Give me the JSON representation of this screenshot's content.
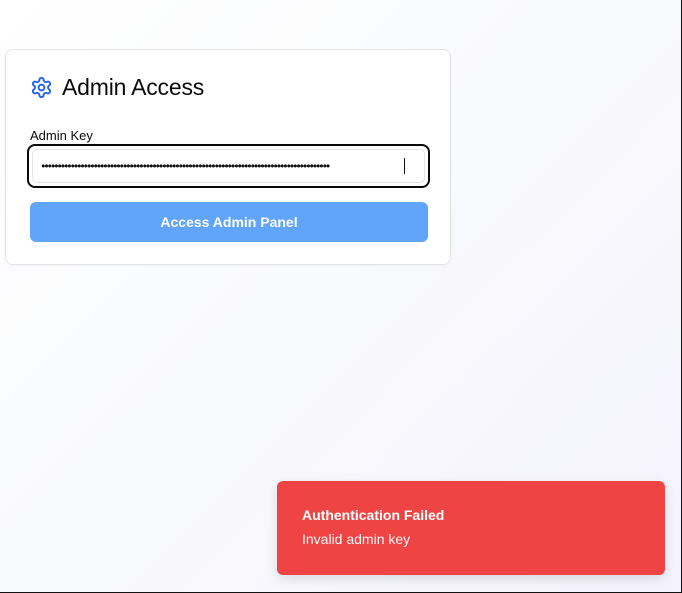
{
  "card": {
    "title": "Admin Access",
    "icon": "gear-icon",
    "key_label": "Admin Key",
    "key_value_masked": "••••••••••••••••••••••••••••••••••••••••••••••••••••••••••••••••••••••••••••••••••••••••",
    "submit_label": "Access Admin Panel"
  },
  "toast": {
    "title": "Authentication Failed",
    "description": "Invalid admin key"
  },
  "colors": {
    "accent": "#2563eb",
    "button": "#60a5fa",
    "toast_bg": "#ef4444"
  }
}
